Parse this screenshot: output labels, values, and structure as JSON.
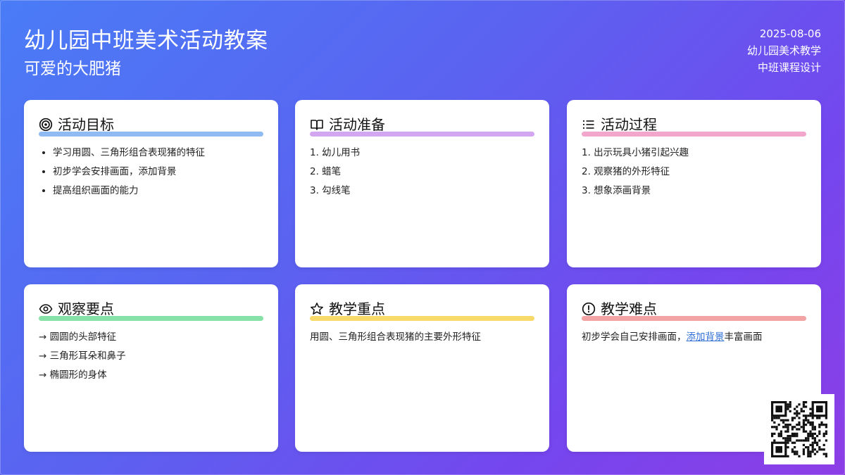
{
  "header": {
    "title": "幼儿园中班美术活动教案",
    "subtitle": "可爱的大肥猪",
    "date": "2025-08-06",
    "org": "幼儿园美术教学",
    "course": "中班课程设计"
  },
  "cards": {
    "goals": {
      "title": "活动目标",
      "icon": "target-icon",
      "color": "#8fbaf2",
      "items": [
        "学习用圆、三角形组合表现猪的特征",
        "初步学会安排画面，添加背景",
        "提高组织画面的能力"
      ]
    },
    "prep": {
      "title": "活动准备",
      "icon": "book-icon",
      "color": "#d3a6f2",
      "items": [
        "1. 幼儿用书",
        "2. 蜡笔",
        "3. 勾线笔"
      ]
    },
    "process": {
      "title": "活动过程",
      "icon": "list-icon",
      "color": "#f2a6cc",
      "items": [
        "1. 出示玩具小猪引起兴趣",
        "2. 观察猪的外形特征",
        "3. 想象添画背景"
      ]
    },
    "observe": {
      "title": "观察要点",
      "icon": "eye-icon",
      "color": "#86e2a6",
      "items": [
        "→ 圆圆的头部特征",
        "→ 三角形耳朵和鼻子",
        "→ 椭圆形的身体"
      ]
    },
    "focus": {
      "title": "教学重点",
      "icon": "star-icon",
      "color": "#f7da6a",
      "text": "用圆、三角形组合表现猪的主要外形特征"
    },
    "difficulty": {
      "title": "教学难点",
      "icon": "alert-icon",
      "color": "#f2a3a3",
      "text_before": "初步学会自己安排画面，",
      "link": "添加背景",
      "text_after": "丰富画面"
    }
  },
  "qr": {
    "icon": "qr-code-icon"
  }
}
